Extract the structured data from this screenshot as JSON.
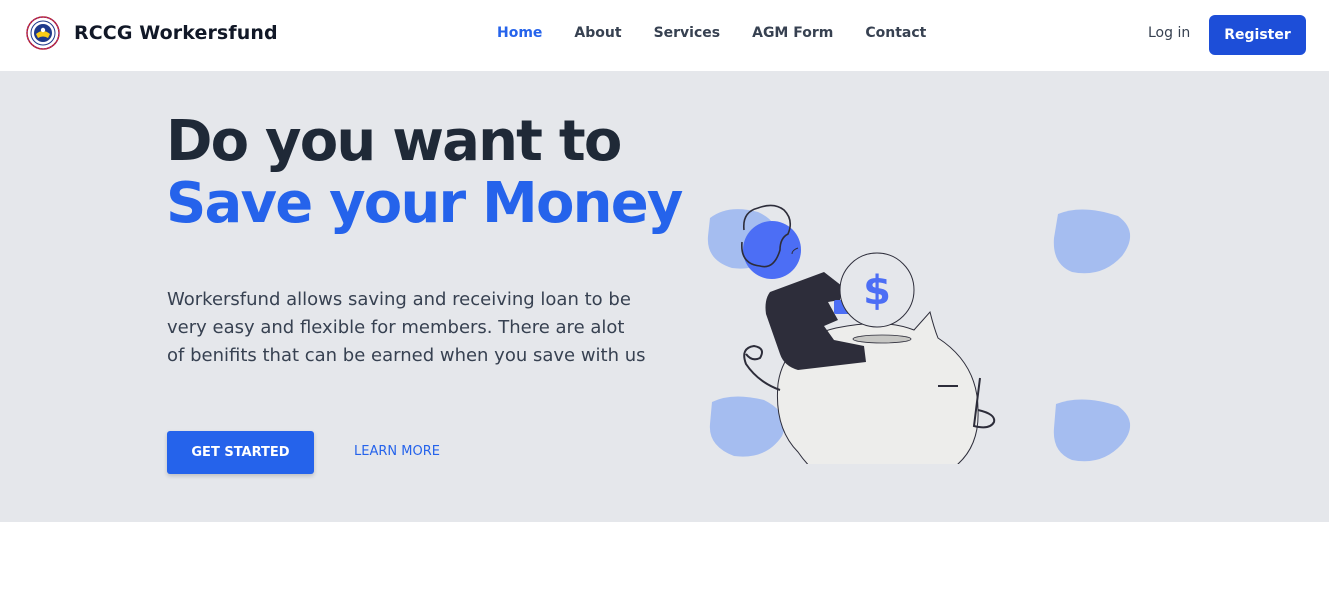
{
  "navbar": {
    "brand_name": "RCCG Workersfund",
    "links": [
      {
        "label": "Home",
        "active": true
      },
      {
        "label": "About",
        "active": false
      },
      {
        "label": "Services",
        "active": false
      },
      {
        "label": "AGM Form",
        "active": false
      },
      {
        "label": "Contact",
        "active": false
      }
    ],
    "login_label": "Log in",
    "register_label": "Register"
  },
  "hero": {
    "headline_line1": "Do you want to",
    "headline_line2": "Save your Money",
    "description": "Workersfund allows saving and receiving loan to be very easy and flexible for members. There are alot of benifits that can be earned when you save with us",
    "primary_button": "GET STARTED",
    "secondary_button": "LEARN MORE",
    "illustration_icon": "dollar-coin-icon",
    "illustration_symbol": "$"
  },
  "colors": {
    "accent": "#2563eb",
    "register_bg": "#1d4ed8",
    "hero_bg": "#e5e7eb",
    "heading_dark": "#1f2937",
    "blob": "#a5bdf0",
    "figure_dark": "#2d2d3a"
  }
}
